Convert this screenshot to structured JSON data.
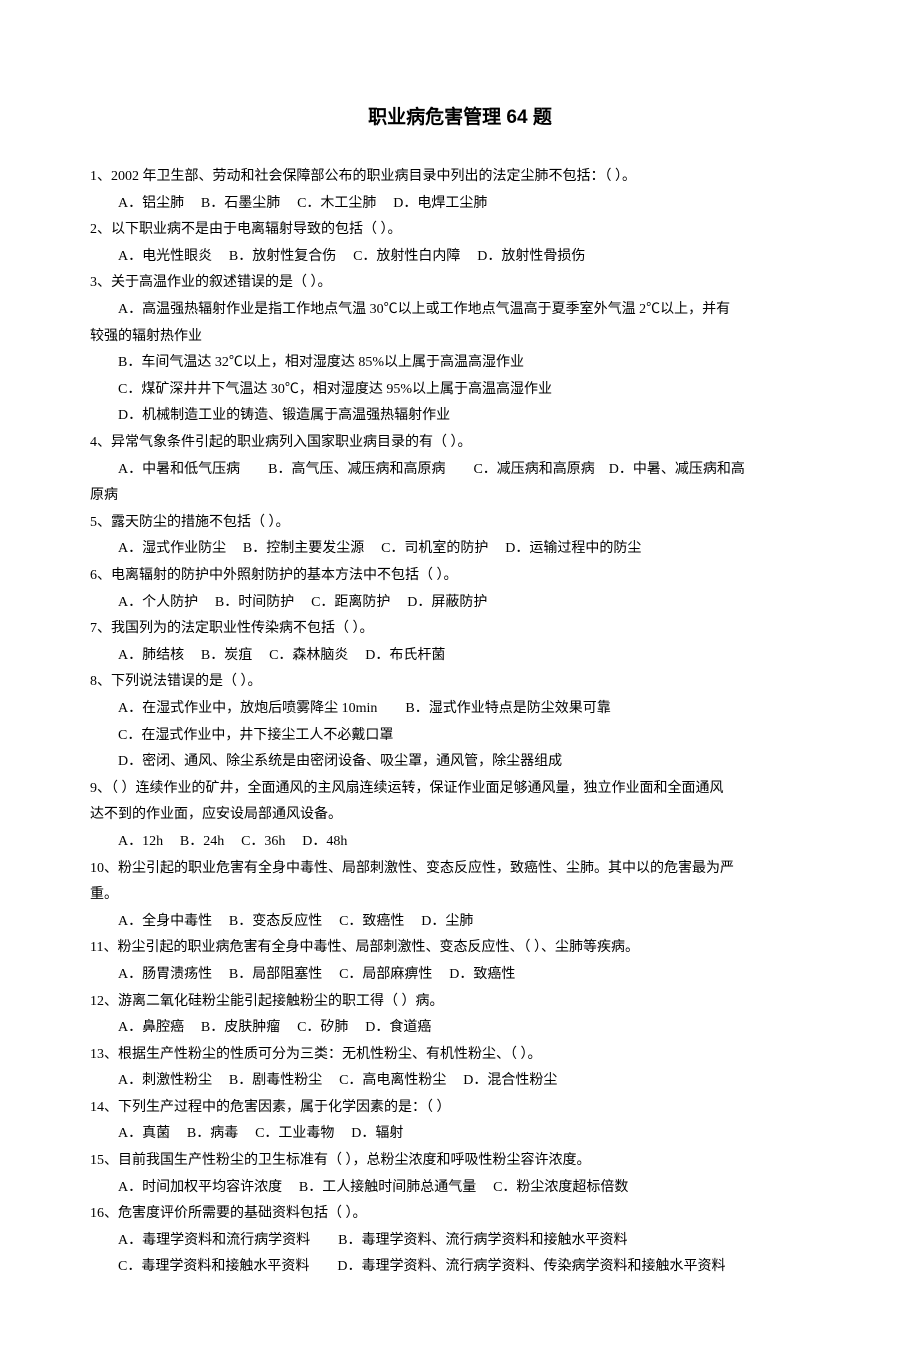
{
  "title": "职业病危害管理 64 题",
  "items": [
    {
      "q": "1、2002 年卫生部、劳动和社会保障部公布的职业病目录中列出的法定尘肺不包括：（ ）。",
      "opts": [
        "A．铝尘肺",
        "B．石墨尘肺",
        "C．木工尘肺",
        "D．电焊工尘肺"
      ]
    },
    {
      "q": "2、以下职业病不是由于电离辐射导致的包括（ ）。",
      "opts": [
        "A．电光性眼炎",
        "B．放射性复合伤",
        "C．放射性白内障",
        "D．放射性骨损伤"
      ]
    },
    {
      "q": "3、关于高温作业的叙述错误的是（ ）。",
      "lines": [
        "A．高温强热辐射作业是指工作地点气温 30℃以上或工作地点气温高于夏季室外气温 2℃以上，并有较强的辐射热作业",
        "B．车间气温达 32℃以上，相对湿度达 85%以上属于高温高湿作业",
        "C．煤矿深井井下气温达 30℃，相对湿度达 95%以上属于高温高湿作业",
        "D．机械制造工业的铸造、锻造属于高温强热辐射作业"
      ]
    },
    {
      "q": "4、异常气象条件引起的职业病列入国家职业病目录的有（ ）。",
      "lines": [
        "A．中暑和低气压病　　B．高气压、减压病和高原病　　C．减压病和高原病　D．中暑、减压病和高原病"
      ]
    },
    {
      "q": "5、露天防尘的措施不包括（ ）。",
      "opts": [
        "A．湿式作业防尘",
        "B．控制主要发尘源",
        "C．司机室的防护",
        "D．运输过程中的防尘"
      ]
    },
    {
      "q": "6、电离辐射的防护中外照射防护的基本方法中不包括（ ）。",
      "opts": [
        "A．个人防护",
        "B．时间防护",
        "C．距离防护",
        "D．屏蔽防护"
      ]
    },
    {
      "q": "7、我国列为的法定职业性传染病不包括（ ）。",
      "opts": [
        "A．肺结核",
        "B．炭疽",
        "C．森林脑炎",
        "D．布氏杆菌"
      ]
    },
    {
      "q": "8、下列说法错误的是（ ）。",
      "lines": [
        "A．在湿式作业中，放炮后喷雾降尘 10min　　B．湿式作业特点是防尘效果可靠",
        "C．在湿式作业中，井下接尘工人不必戴口罩",
        "D．密闭、通风、除尘系统是由密闭设备、吸尘罩，通风管，除尘器组成"
      ]
    },
    {
      "q": "9、（ ）连续作业的矿井，全面通风的主风扇连续运转，保证作业面足够通风量，独立作业面和全面通风达不到的作业面，应安设局部通风设备。",
      "opts": [
        "A．12h",
        "B．24h",
        "C．36h",
        "D．48h"
      ]
    },
    {
      "q": "10、粉尘引起的职业危害有全身中毒性、局部刺激性、变态反应性，致癌性、尘肺。其中以的危害最为严重。",
      "opts": [
        "A．全身中毒性",
        "B．变态反应性",
        "C．致癌性",
        "D．尘肺"
      ]
    },
    {
      "q": "11、粉尘引起的职业病危害有全身中毒性、局部刺激性、变态反应性、（ ）、尘肺等疾病。",
      "opts": [
        "A．肠胃溃疡性",
        "B．局部阻塞性",
        "C．局部麻痹性",
        "D．致癌性"
      ]
    },
    {
      "q": "12、游离二氧化硅粉尘能引起接触粉尘的职工得（ ）病。",
      "opts": [
        "A．鼻腔癌",
        "B．皮肤肿瘤",
        "C．矽肺",
        "D．食道癌"
      ]
    },
    {
      "q": "13、根据生产性粉尘的性质可分为三类：无机性粉尘、有机性粉尘、（ ）。",
      "opts": [
        "A．刺激性粉尘",
        "B．剧毒性粉尘",
        "C．高电离性粉尘",
        "D．混合性粉尘"
      ]
    },
    {
      "q": "14、下列生产过程中的危害因素，属于化学因素的是：（ ）",
      "opts": [
        "A．真菌",
        "B．病毒",
        "C．工业毒物",
        "D．辐射"
      ]
    },
    {
      "q": "15、目前我国生产性粉尘的卫生标准有（ ），总粉尘浓度和呼吸性粉尘容许浓度。",
      "opts": [
        "A．时间加权平均容许浓度",
        "B．工人接触时间肺总通气量",
        "C．粉尘浓度超标倍数"
      ]
    },
    {
      "q": "16、危害度评价所需要的基础资料包括（ ）。",
      "lines": [
        "A．毒理学资料和流行病学资料　　B．毒理学资料、流行病学资料和接触水平资料",
        "C．毒理学资料和接触水平资料　　D．毒理学资料、流行病学资料、传染病学资料和接触水平资料"
      ]
    }
  ]
}
